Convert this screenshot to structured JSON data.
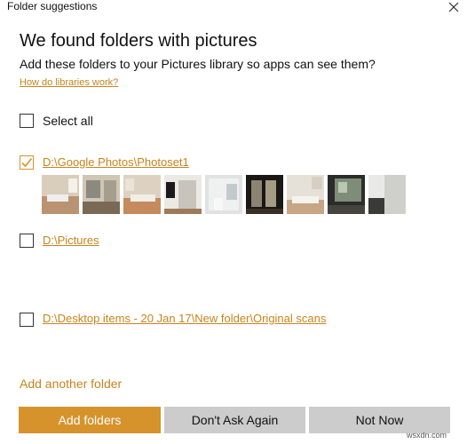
{
  "window": {
    "title": "Folder suggestions",
    "close_icon": "close-icon"
  },
  "dialog": {
    "heading": "We found folders with pictures",
    "subtitle": "Add these folders to your Pictures library so apps can see them?",
    "help_link": "How do libraries work?",
    "select_all_label": "Select all",
    "select_all_checked": false,
    "folders": [
      {
        "path": "D:\\Google Photos\\Photoset1",
        "checked": true,
        "thumbnail_count": 9
      },
      {
        "path": "D:\\Pictures",
        "checked": false
      },
      {
        "path": "D:\\Desktop items - 20 Jan 17\\New folder\\Original scans",
        "checked": false
      }
    ],
    "add_another": "Add another folder"
  },
  "buttons": {
    "add_folders": "Add folders",
    "dont_ask": "Don't Ask Again",
    "not_now": "Not Now"
  },
  "colors": {
    "accent": "#d6932c",
    "link": "#c8841c",
    "secondary_button": "#cccccc"
  },
  "watermark": "wsxdn.com"
}
